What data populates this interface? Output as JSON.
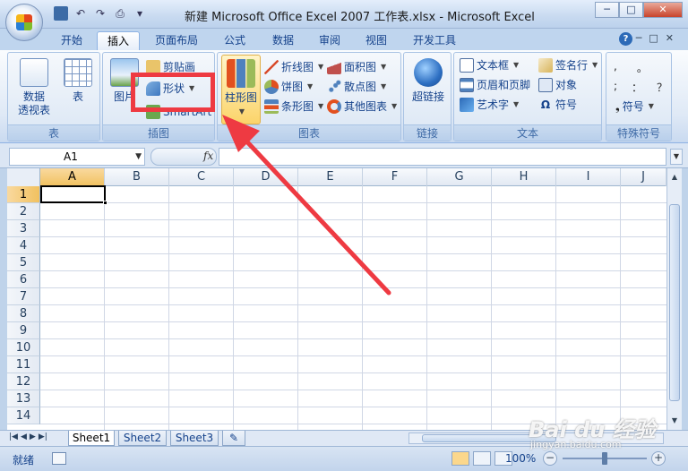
{
  "window": {
    "title": "新建 Microsoft Office Excel 2007 工作表.xlsx - Microsoft Excel",
    "minimize": "─",
    "maximize": "□",
    "close": "✕"
  },
  "tabs": [
    "开始",
    "插入",
    "页面布局",
    "公式",
    "数据",
    "审阅",
    "视图",
    "开发工具"
  ],
  "ribbon": {
    "tables": {
      "pivot": "数据\n透视表",
      "table": "表",
      "label": "表"
    },
    "illustrations": {
      "picture": "图片",
      "clipart": "剪贴画",
      "shapes": "形状",
      "smartart": "SmartArt",
      "label": "插图"
    },
    "charts": {
      "column": "柱形图",
      "line": "折线图",
      "pie": "饼图",
      "bar": "条形图",
      "area": "面积图",
      "scatter": "散点图",
      "other": "其他图表",
      "label": "图表"
    },
    "links": {
      "hyperlink": "超链接",
      "label": "链接"
    },
    "text": {
      "textbox": "文本框",
      "header_footer": "页眉和页脚",
      "wordart": "艺术字",
      "signature": "签名行",
      "object": "对象",
      "symbol": "符号",
      "label": "文本"
    },
    "special": {
      "symbol": "符号",
      "label": "特殊符号",
      "chars": [
        ",",
        "。",
        ";",
        "：",
        "？"
      ]
    }
  },
  "formula_bar": {
    "name_box": "A1",
    "fx": "fx",
    "value": ""
  },
  "sheet": {
    "columns": [
      "A",
      "B",
      "C",
      "D",
      "E",
      "F",
      "G",
      "H",
      "I",
      "J"
    ],
    "rows": [
      "1",
      "2",
      "3",
      "4",
      "5",
      "6",
      "7",
      "8",
      "9",
      "10",
      "11",
      "12",
      "13",
      "14"
    ],
    "selected_cell": "A1"
  },
  "sheet_tabs": [
    "Sheet1",
    "Sheet2",
    "Sheet3"
  ],
  "status": {
    "ready": "就绪",
    "zoom": "100%"
  },
  "watermark": {
    "brand": "Bai du 经验",
    "url": "jingyan.baidu.com"
  },
  "colors": {
    "highlight": "#ee3a42",
    "accent": "#15428b"
  }
}
